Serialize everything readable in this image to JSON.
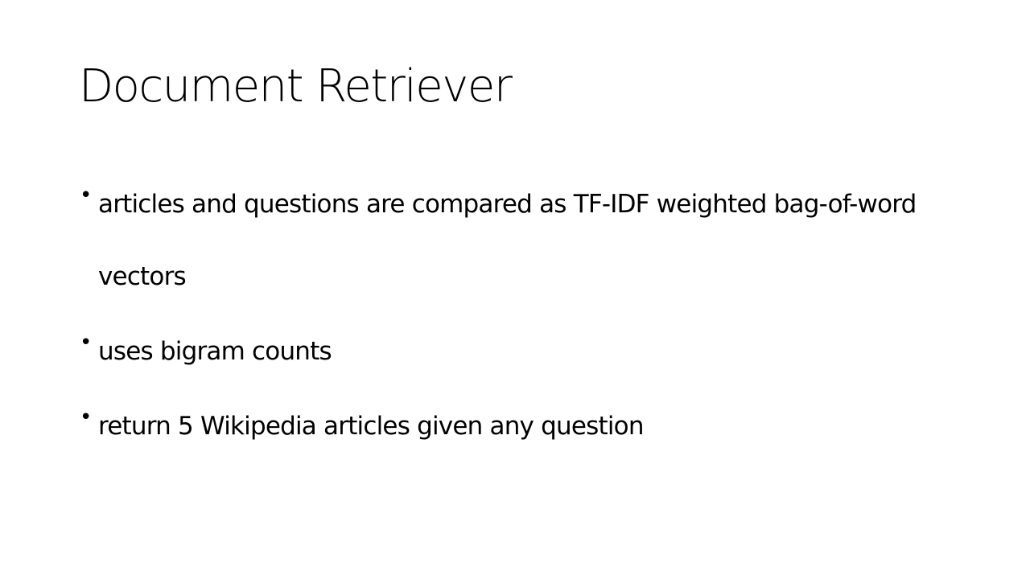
{
  "slide": {
    "title": "Document Retriever",
    "bullets": [
      {
        "text": "articles and questions are compared as TF-IDF weighted bag-of-word vectors"
      },
      {
        "text": "uses bigram counts"
      },
      {
        "text": "return 5 Wikipedia articles given any question"
      }
    ]
  }
}
